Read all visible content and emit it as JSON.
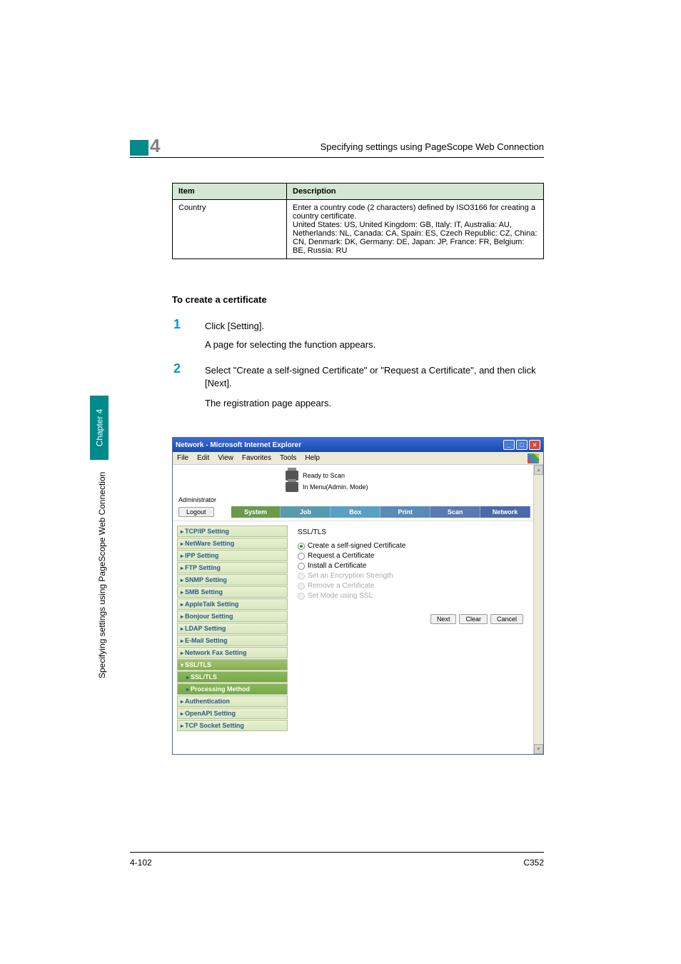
{
  "header": {
    "chapter_num": "4",
    "title": "Specifying settings using PageScope Web Connection"
  },
  "table": {
    "head_item": "Item",
    "head_desc": "Description",
    "row_item": "Country",
    "row_desc": "Enter a country code (2 characters) defined by ISO3166 for creating a country certificate.\nUnited States: US, United Kingdom: GB, Italy: IT, Australia: AU, Netherlands: NL, Canada: CA, Spain: ES, Czech Republic: CZ, China: CN, Denmark: DK, Germany: DE, Japan: JP, France: FR, Belgium: BE, Russia: RU"
  },
  "subheading": "To create a certificate",
  "steps": {
    "s1_num": "1",
    "s1_text": "Click [Setting].",
    "s1_sub": "A page for selecting the function appears.",
    "s2_num": "2",
    "s2_text": "Select \"Create a self-signed Certificate\" or \"Request a Certificate\", and then click [Next].",
    "s2_sub": "The registration page appears."
  },
  "side": {
    "rotated": "Specifying settings using PageScope Web Connection",
    "chapter": "Chapter 4"
  },
  "footer": {
    "left": "4-102",
    "right": "C352"
  },
  "screenshot": {
    "title": "Network - Microsoft Internet Explorer",
    "menu": {
      "file": "File",
      "edit": "Edit",
      "view": "View",
      "favorites": "Favorites",
      "tools": "Tools",
      "help": "Help"
    },
    "status1": "Ready to Scan",
    "status2": "In Menu(Admin. Mode)",
    "admin": "Administrator",
    "logout": "Logout",
    "tabs": {
      "system": "System",
      "job": "Job",
      "box": "Box",
      "print": "Print",
      "scan": "Scan",
      "network": "Network"
    },
    "nav": {
      "tcpip": "TCP/IP Setting",
      "netware": "NetWare Setting",
      "ipp": "IPP Setting",
      "ftp": "FTP Setting",
      "snmp": "SNMP Setting",
      "smb": "SMB Setting",
      "appletalk": "AppleTalk Setting",
      "bonjour": "Bonjour Setting",
      "ldap": "LDAP Setting",
      "email": "E-Mail Setting",
      "netfax": "Network Fax Setting",
      "ssltls": "SSL/TLS",
      "ssltls_sub": "SSL/TLS",
      "processing": "Processing Method",
      "auth": "Authentication",
      "openapi": "OpenAPI Setting",
      "tcpsocket": "TCP Socket Setting"
    },
    "main": {
      "title": "SSL/TLS",
      "opt1": "Create a self-signed Certificate",
      "opt2": "Request a Certificate",
      "opt3": "Install a Certificate",
      "opt4": "Set an Encryption Strength",
      "opt5": "Remove a Certificate",
      "opt6": "Set Mode using SSL",
      "btn_next": "Next",
      "btn_clear": "Clear",
      "btn_cancel": "Cancel"
    }
  }
}
